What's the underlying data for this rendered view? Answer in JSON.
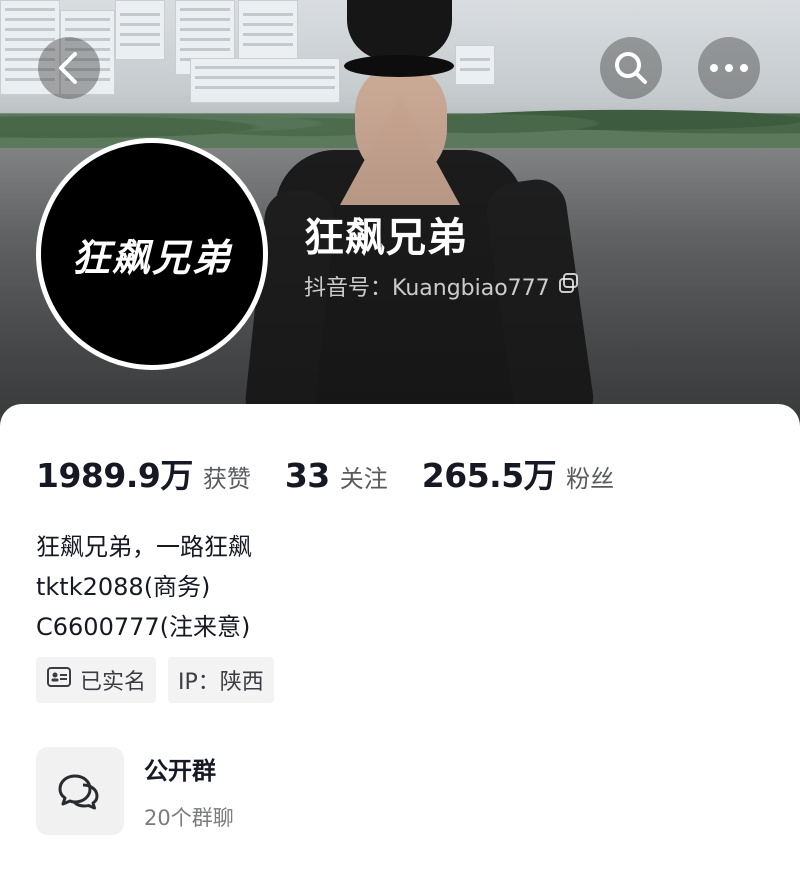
{
  "header": {
    "back_icon": "chevron-left-icon",
    "search_icon": "search-icon",
    "more_icon": "more-dots-icon"
  },
  "profile": {
    "avatar_text": "狂飙兄弟",
    "nickname": "狂飙兄弟",
    "account_label": "抖音号：Kuangbiao777",
    "copy_icon": "copy-icon"
  },
  "stats": [
    {
      "value": "1989.9万",
      "label": "获赞"
    },
    {
      "value": "33",
      "label": "关注"
    },
    {
      "value": "265.5万",
      "label": "粉丝"
    }
  ],
  "bio": {
    "line1": "狂飙兄弟，一路狂飙",
    "line2": "tktk2088(商务)",
    "line3": "C6600777(注来意)"
  },
  "tags": {
    "verified": "已实名",
    "ip": "IP：陕西"
  },
  "group": {
    "title": "公开群",
    "subtitle": "20个群聊",
    "icon": "chat-bubbles-icon"
  },
  "colors": {
    "text_primary": "#161823",
    "text_secondary": "#5a5b60",
    "tag_bg": "#f3f3f4"
  }
}
